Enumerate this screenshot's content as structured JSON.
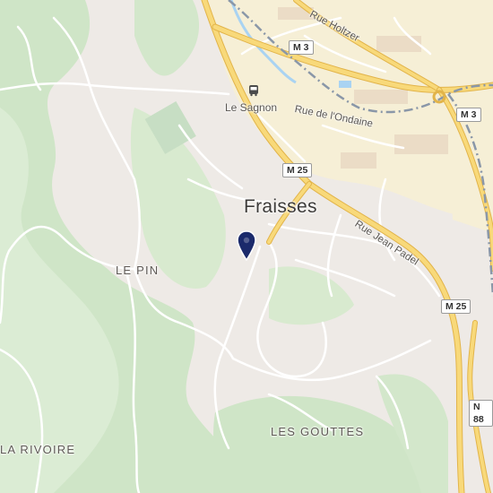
{
  "map": {
    "town_label": "Fraisses",
    "locality_labels": {
      "le_pin": "LE PIN",
      "la_rivoire": "LA RIVOIRE",
      "les_gouttes": "LES GOUTTES"
    },
    "place_labels": {
      "le_sagnon": "Le Sagnon"
    },
    "street_labels": {
      "rue_holtzer": "Rue Holtzer",
      "rue_ondaine": "Rue de l'Ondaine",
      "rue_jean_padel": "Rue Jean Padel"
    },
    "road_shields": {
      "m3_top": "M 3",
      "m3_right": "M 3",
      "m25_center": "M 25",
      "m25_right": "M 25",
      "n88": "N 88"
    },
    "icons": {
      "marker": "location-pin-icon",
      "bus": "bus-stop-icon"
    },
    "colors": {
      "background": "#eeeae6",
      "forest": "#cfe5c7",
      "industrial": "#f6efd6",
      "major_road": "#f4c95d",
      "railway": "#8a97a8",
      "water": "#a9d3f2",
      "marker": "#1b2a6b"
    }
  }
}
